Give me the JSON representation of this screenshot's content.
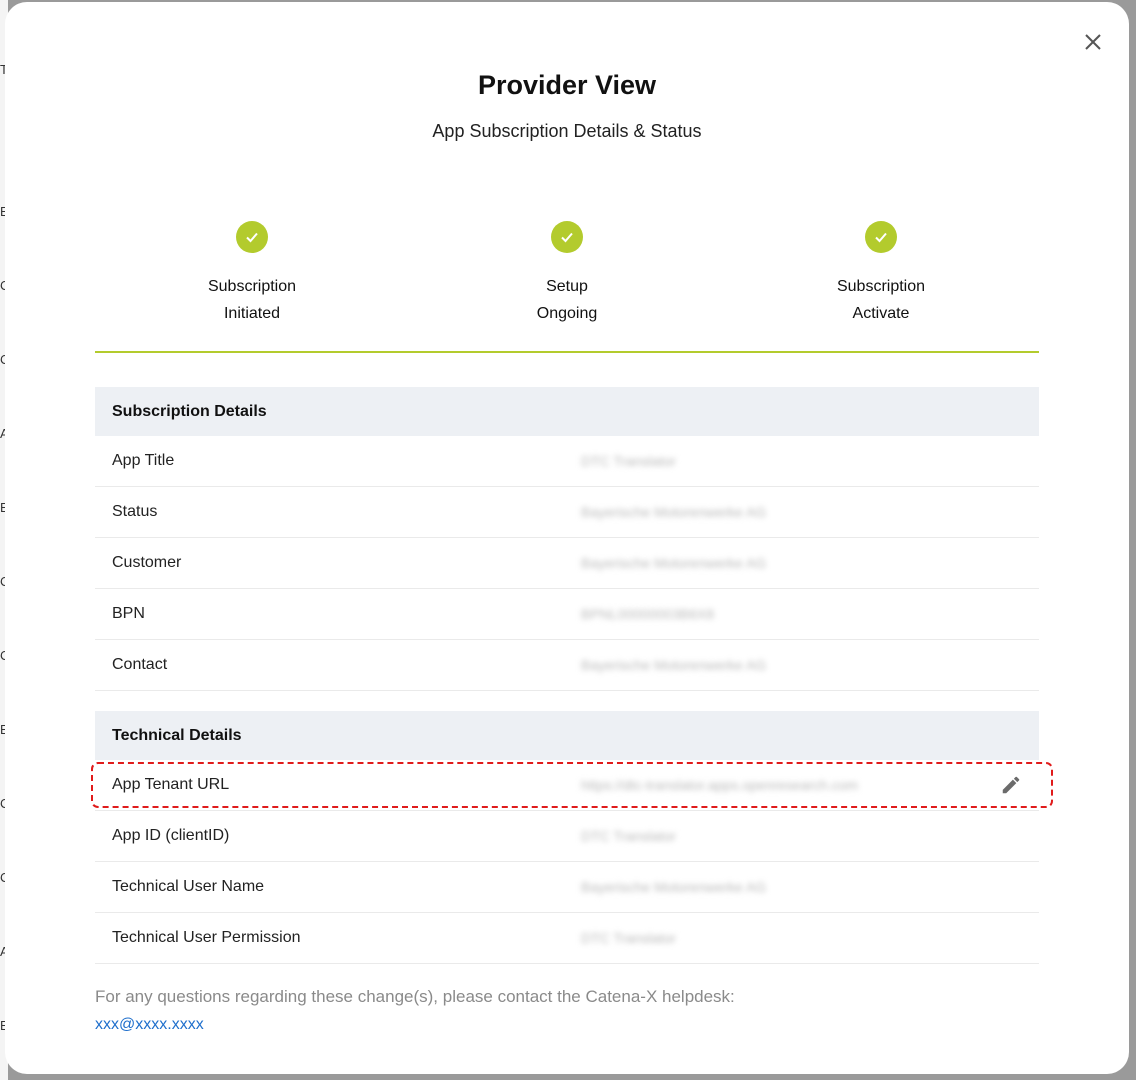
{
  "modal": {
    "title": "Provider View",
    "subtitle": "App Subscription Details & Status"
  },
  "stepper": {
    "accent_color": "#b3cb2d",
    "steps": [
      {
        "line1": "Subscription",
        "line2": "Initiated",
        "status": "complete"
      },
      {
        "line1": "Setup",
        "line2": "Ongoing",
        "status": "complete"
      },
      {
        "line1": "Subscription",
        "line2": "Activate",
        "status": "complete"
      }
    ]
  },
  "subscription_details": {
    "header": "Subscription Details",
    "rows": [
      {
        "key": "App Title",
        "value": "DTC Translator"
      },
      {
        "key": "Status",
        "value": "Bayerische Motorenwerke AG"
      },
      {
        "key": "Customer",
        "value": "Bayerische Motorenwerke AG"
      },
      {
        "key": "BPN",
        "value": "BPNL00000003B6X8"
      },
      {
        "key": "Contact",
        "value": "Bayerische Motorenwerke AG"
      }
    ]
  },
  "technical_details": {
    "header": "Technical Details",
    "rows": [
      {
        "key": "App Tenant URL",
        "value": "https://dtc-translator.apps.openresearch.com",
        "editable": true
      },
      {
        "key": "App ID (clientID)",
        "value": "DTC Translator"
      },
      {
        "key": "Technical User Name",
        "value": "Bayerische Motorenwerke AG"
      },
      {
        "key": "Technical User Permission",
        "value": "DTC Translator"
      }
    ]
  },
  "footer": {
    "text": "For any questions regarding these change(s), please contact the Catena-X helpdesk:",
    "email": "xxx@xxxx.xxxx"
  },
  "icons": {
    "close": "close-icon",
    "check": "check-icon",
    "edit": "pencil-icon"
  },
  "colors": {
    "highlight_border": "#e01b1b",
    "section_header_bg": "#edf0f4",
    "link": "#1f6fcc"
  }
}
